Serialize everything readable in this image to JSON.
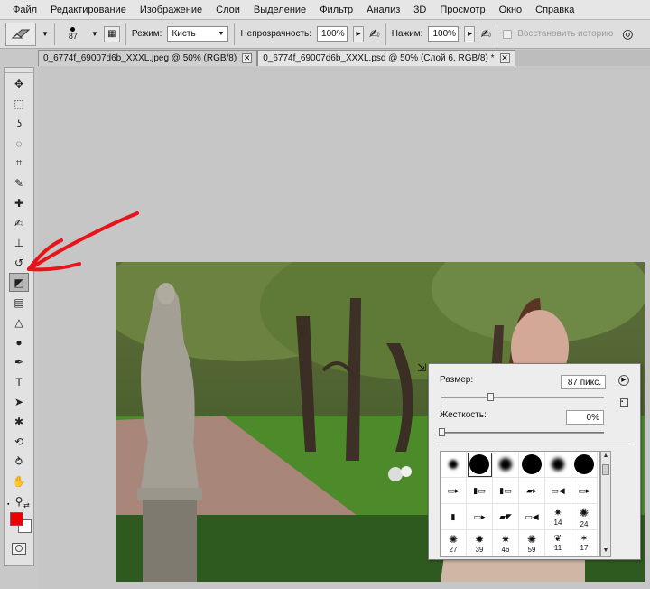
{
  "menu": [
    "Файл",
    "Редактирование",
    "Изображение",
    "Слои",
    "Выделение",
    "Фильтр",
    "Анализ",
    "3D",
    "Просмотр",
    "Окно",
    "Справка"
  ],
  "options": {
    "brush_size": "87",
    "mode_label": "Режим:",
    "mode_value": "Кисть",
    "opacity_label": "Непрозрачность:",
    "opacity_value": "100%",
    "flow_label": "Нажим:",
    "flow_value": "100%",
    "restore_history": "Восстановить историю"
  },
  "tabs": [
    {
      "label": "0_6774f_69007d6b_XXXL.jpeg @ 50% (RGB/8)"
    },
    {
      "label": "0_6774f_69007d6b_XXXL.psd @ 50% (Слой 6, RGB/8) *"
    }
  ],
  "tab_close": "✕",
  "tools": [
    {
      "name": "move-tool",
      "glyph": "✥"
    },
    {
      "name": "marquee-tool",
      "glyph": "⬚"
    },
    {
      "name": "lasso-tool",
      "glyph": "ʖ"
    },
    {
      "name": "quick-select-tool",
      "glyph": "◌"
    },
    {
      "name": "crop-tool",
      "glyph": "⌗"
    },
    {
      "name": "eyedropper-tool",
      "glyph": "✎"
    },
    {
      "name": "spot-healing-tool",
      "glyph": "✚"
    },
    {
      "name": "brush-tool",
      "glyph": "✍"
    },
    {
      "name": "stamp-tool",
      "glyph": "⊥"
    },
    {
      "name": "history-brush-tool",
      "glyph": "↺"
    },
    {
      "name": "eraser-tool",
      "glyph": "◩"
    },
    {
      "name": "gradient-tool",
      "glyph": "▤"
    },
    {
      "name": "blur-tool",
      "glyph": "△"
    },
    {
      "name": "dodge-tool",
      "glyph": "●"
    },
    {
      "name": "pen-tool",
      "glyph": "✒"
    },
    {
      "name": "type-tool",
      "glyph": "T"
    },
    {
      "name": "path-select-tool",
      "glyph": "➤"
    },
    {
      "name": "shape-tool",
      "glyph": "✱"
    },
    {
      "name": "3d-rotate-tool",
      "glyph": "⟲"
    },
    {
      "name": "3d-orbit-tool",
      "glyph": "⥁"
    },
    {
      "name": "hand-tool",
      "glyph": "✋"
    },
    {
      "name": "zoom-tool",
      "glyph": "⚲"
    }
  ],
  "colors": {
    "foreground": "#ee0000",
    "background": "#ffffff",
    "annotation": "#e8141c"
  },
  "brush_panel": {
    "size_label": "Размер:",
    "size_value": "87 пикс.",
    "size_level_percent": 30,
    "hardness_label": "Жесткость:",
    "hardness_value": "0%",
    "hardness_level_percent": 0,
    "presets_row3": [
      "",
      "",
      "",
      "",
      "14",
      "24"
    ],
    "presets_row4": [
      "27",
      "39",
      "46",
      "59",
      "11",
      "17"
    ]
  }
}
